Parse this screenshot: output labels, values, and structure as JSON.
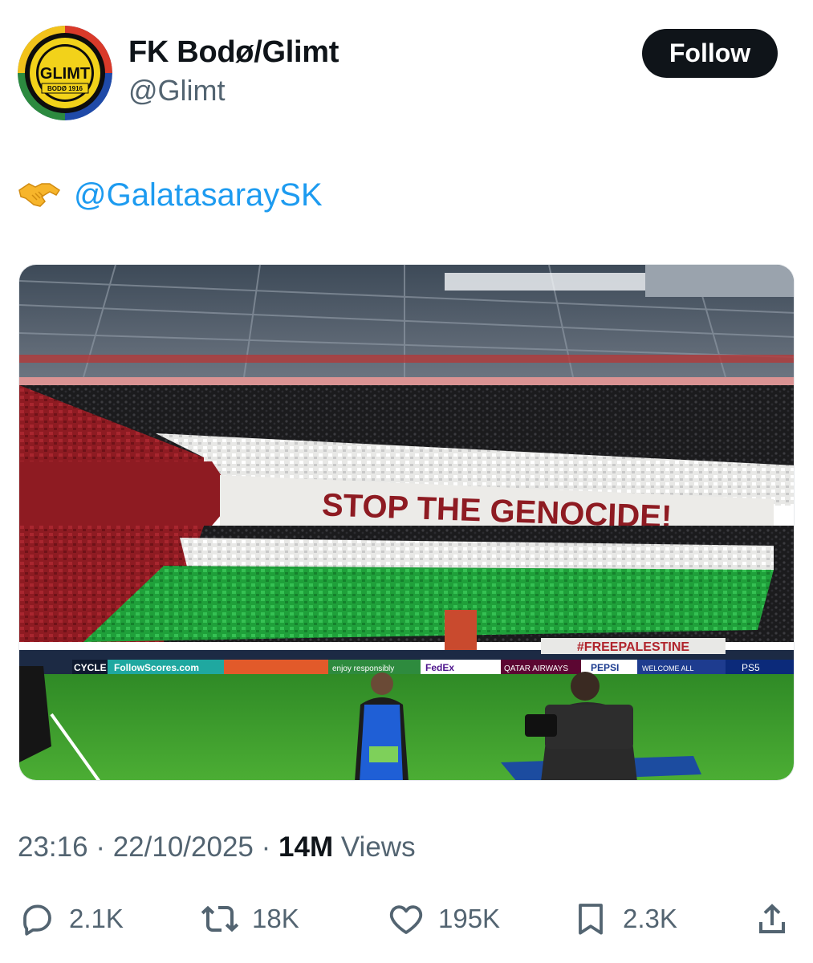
{
  "author": {
    "name": "FK Bodø/Glimt",
    "handle": "@Glimt",
    "avatar_text_top": "GLIMT",
    "avatar_text_bottom": "BODØ 1916"
  },
  "follow_label": "Follow",
  "tweet": {
    "emoji_icon": "handshake-icon",
    "mention": "@GalatasaraySK"
  },
  "media": {
    "banner_text": "STOP THE GENOCIDE!",
    "pitch_banner_text": "#FREEPALESTINE",
    "ad_boards": [
      "CYCLE",
      "FollowScores.com",
      "enjoy responsibly",
      "FedEx",
      "QATAR AIRWAYS",
      "PEPSI",
      "WELCOME ALL",
      "PS5"
    ],
    "colors": {
      "red": "#8e1b22",
      "green": "#1fa03a",
      "white": "#e8e8e6",
      "black": "#1b1b1d",
      "pitch": "#3f9a2c"
    }
  },
  "meta": {
    "time": "23:16",
    "date": "22/10/2025",
    "views_count": "14M",
    "views_label": "Views",
    "separator": "·"
  },
  "actions": {
    "replies": "2.1K",
    "reposts": "18K",
    "likes": "195K",
    "bookmarks": "2.3K"
  },
  "colors": {
    "accent": "#1d9bf0",
    "text": "#0f1419",
    "muted": "#536471",
    "button": "#0f1419"
  }
}
